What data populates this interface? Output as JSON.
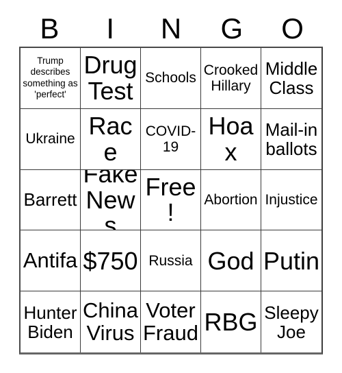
{
  "card": {
    "header_letters": [
      "B",
      "I",
      "N",
      "G",
      "O"
    ],
    "columns": 5,
    "rows": 5,
    "free_space_label": "Free!",
    "free_space_index": 12,
    "colors": {
      "text": "#000000",
      "background": "#ffffff",
      "grid_line": "#3a3a3a",
      "outer_border": "#4a4a4a"
    },
    "cells": [
      {
        "text": "Trump describes something as 'perfect'",
        "size": "sz-xs"
      },
      {
        "text": "Drug Test",
        "size": "sz-xxl"
      },
      {
        "text": "Schools",
        "size": "sz-md"
      },
      {
        "text": "Crooked Hillary",
        "size": "sz-md"
      },
      {
        "text": "Middle Class",
        "size": "sz-lg"
      },
      {
        "text": "Ukraine",
        "size": "sz-md"
      },
      {
        "text": "Race",
        "size": "sz-xxl"
      },
      {
        "text": "COVID-19",
        "size": "sz-md"
      },
      {
        "text": "Hoax",
        "size": "sz-xxl"
      },
      {
        "text": "Mail-in ballots",
        "size": "sz-lg"
      },
      {
        "text": "Barrett",
        "size": "sz-lg"
      },
      {
        "text": "Fake News",
        "size": "sz-xxl"
      },
      {
        "text": "Free!",
        "size": "sz-xxl"
      },
      {
        "text": "Abortion",
        "size": "sz-md"
      },
      {
        "text": "Injustice",
        "size": "sz-md"
      },
      {
        "text": "Antifa",
        "size": "sz-xl"
      },
      {
        "text": "$750",
        "size": "sz-xxl"
      },
      {
        "text": "Russia",
        "size": "sz-md"
      },
      {
        "text": "God",
        "size": "sz-xxl"
      },
      {
        "text": "Putin",
        "size": "sz-xxl"
      },
      {
        "text": "Hunter Biden",
        "size": "sz-lg"
      },
      {
        "text": "China Virus",
        "size": "sz-xl"
      },
      {
        "text": "Voter Fraud",
        "size": "sz-xl"
      },
      {
        "text": "RBG",
        "size": "sz-xxl"
      },
      {
        "text": "Sleepy Joe",
        "size": "sz-lg"
      }
    ]
  }
}
